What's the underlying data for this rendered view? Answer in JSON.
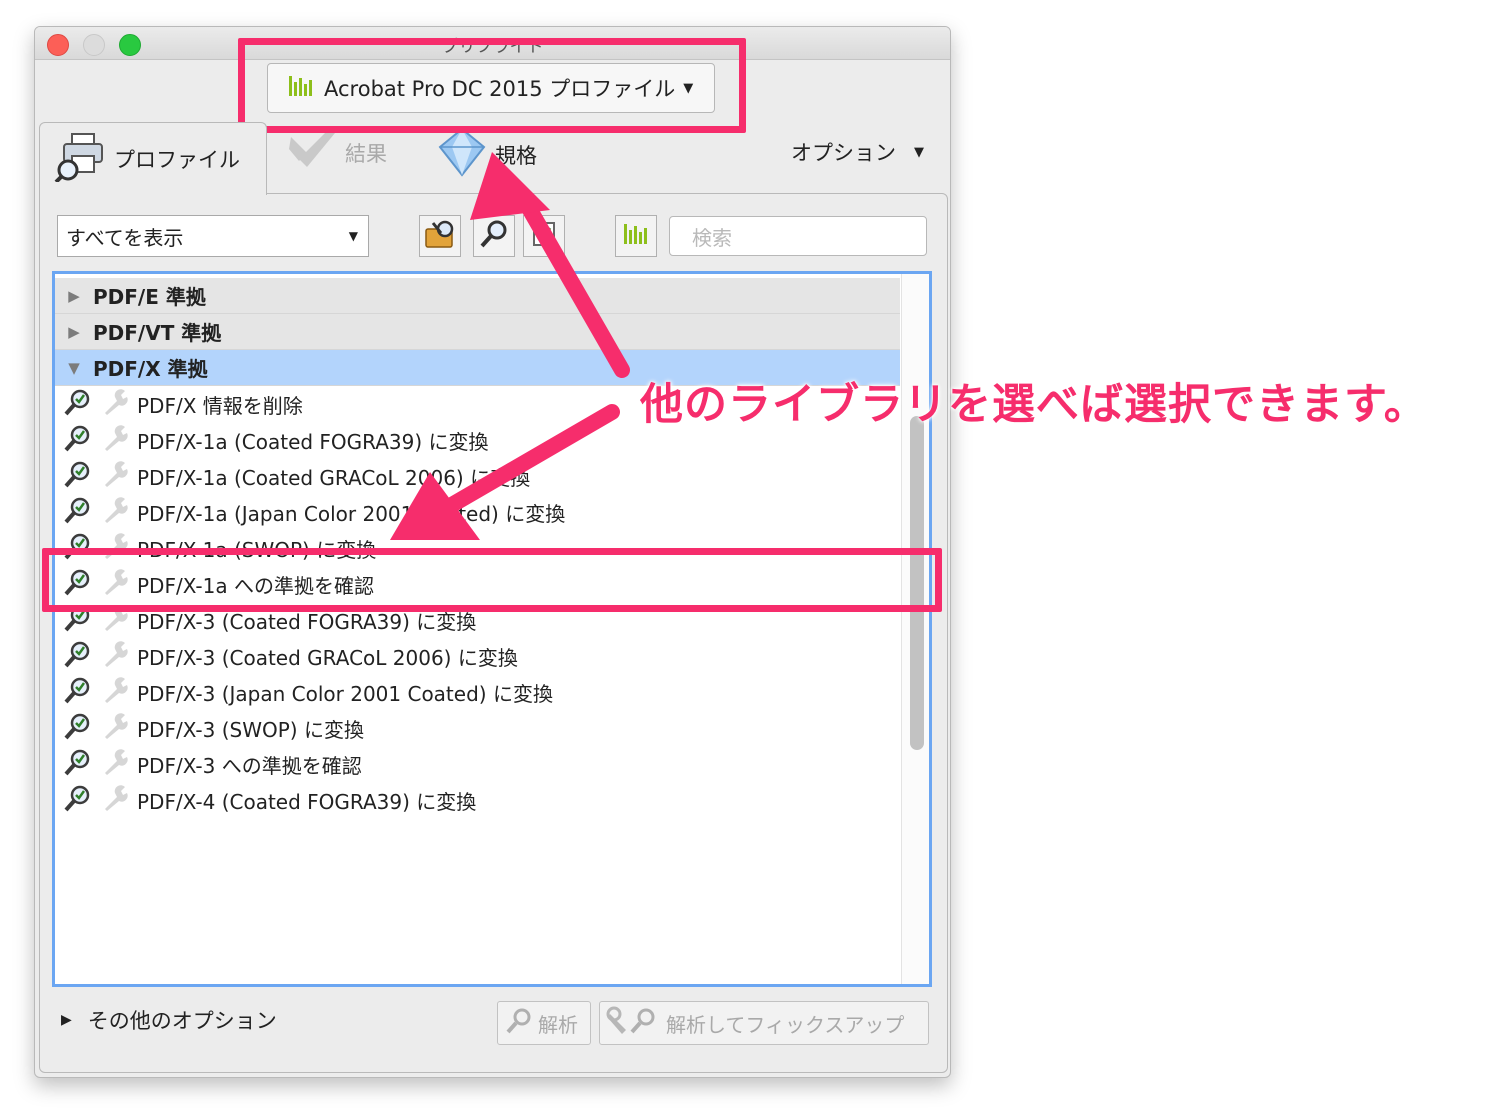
{
  "window": {
    "title": "プリフライト"
  },
  "library": {
    "label": "Acrobat Pro DC 2015 プロファイル",
    "icon": "library-bars-icon"
  },
  "tabs": [
    {
      "label": "プロファイル",
      "icon": "profiles-icon"
    },
    {
      "label": "結果",
      "icon": "results-icon"
    },
    {
      "label": "規格",
      "icon": "standards-diamond-icon"
    }
  ],
  "options_menu": {
    "label": "オプション"
  },
  "filter": {
    "selected": "すべてを表示"
  },
  "search": {
    "placeholder": "検索"
  },
  "groups": [
    {
      "label": "PDF/E 準拠",
      "expanded": false
    },
    {
      "label": "PDF/VT 準拠",
      "expanded": false
    },
    {
      "label": "PDF/X 準拠",
      "expanded": true,
      "selected": true
    }
  ],
  "items": [
    "PDF/X 情報を削除",
    "PDF/X-1a (Coated FOGRA39) に変換",
    "PDF/X-1a (Coated GRACoL 2006) に変換",
    "PDF/X-1a (Japan Color 2001 Coated) に変換",
    "PDF/X-1a (SWOP) に変換",
    "PDF/X-1a への準拠を確認",
    "PDF/X-3 (Coated FOGRA39) に変換",
    "PDF/X-3 (Coated GRACoL 2006) に変換",
    "PDF/X-3 (Japan Color 2001 Coated) に変換",
    "PDF/X-3 (SWOP) に変換",
    "PDF/X-3 への準拠を確認",
    "PDF/X-4 (Coated FOGRA39) に変換"
  ],
  "footer": {
    "more_options": "その他のオプション",
    "analyze": "解析",
    "analyze_fix": "解析してフィックスアップ"
  },
  "annotation": {
    "text": "他のライブラリを選べば選択できます。",
    "color": "#f62d6c"
  },
  "colors": {
    "selection": "#b3d4fc",
    "focus_ring": "#6ba6f2",
    "accent": "#f62d6c"
  }
}
